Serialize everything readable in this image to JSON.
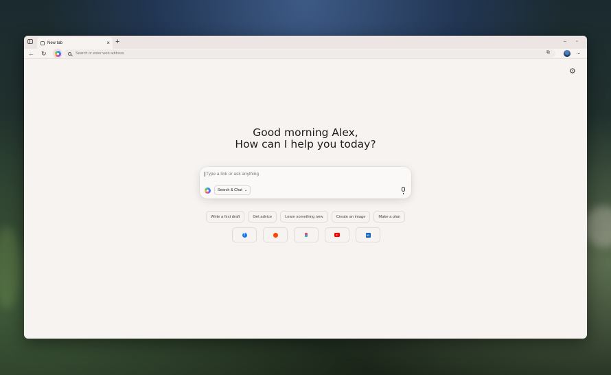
{
  "tab": {
    "title": "New tab",
    "close": "×"
  },
  "toolbar": {
    "new_tab": "+",
    "back": "←",
    "reload": "↻",
    "address_placeholder": "Search or enter web address",
    "minimize": "–",
    "restore": "▫",
    "menu": "···"
  },
  "greeting": {
    "line1": "Good morning Alex,",
    "line2": "How can I help you today?"
  },
  "composer": {
    "placeholder": "Type a link or ask anything",
    "mode": "Search & Chat",
    "chevron": "⌄"
  },
  "suggestions": [
    "Write a first draft",
    "Get advice",
    "Learn something new",
    "Create an image",
    "Make a plan"
  ],
  "shortcuts": [
    {
      "name": "facebook",
      "glyph": "f"
    },
    {
      "name": "reddit"
    },
    {
      "name": "figma"
    },
    {
      "name": "youtube"
    },
    {
      "name": "linkedin",
      "glyph": "in"
    }
  ],
  "icons": {
    "settings": "⚙"
  },
  "colors": {
    "page_bg": "#f7f3f1",
    "titlebar": "#ece5e3",
    "facebook": "#1877f2",
    "reddit": "#ff4500",
    "youtube": "#ff0000",
    "linkedin": "#0a66c2"
  }
}
